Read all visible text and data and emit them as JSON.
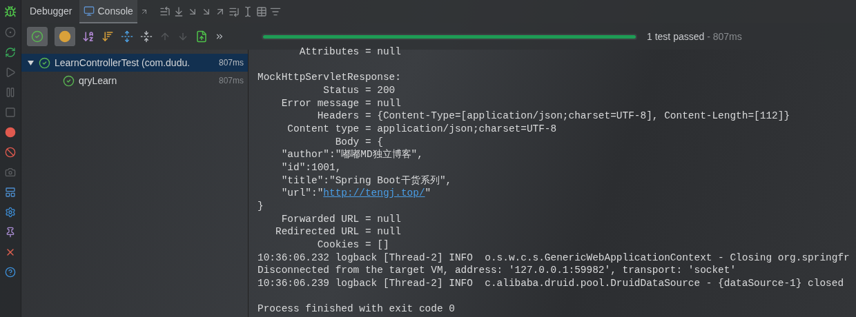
{
  "tabs": [
    {
      "label": "Debugger",
      "selected": false
    },
    {
      "label": "Console",
      "selected": true
    }
  ],
  "filters": [
    {
      "kind": "passed",
      "checked": true
    },
    {
      "kind": "ignored",
      "checked": true
    }
  ],
  "progress": {
    "level": 1.0,
    "status": "1 test passed",
    "time": " - 807ms"
  },
  "tree": [
    {
      "label": "LearnControllerTest (com.dudu.",
      "time": "807ms",
      "expanded": true,
      "selected": true,
      "children": [
        {
          "label": "qryLearn",
          "time": "807ms",
          "selected": false
        }
      ]
    }
  ],
  "console": [
    {
      "text": "       Attributes = null"
    },
    {
      "text": "MockHttpServletResponse:",
      "gap_before": true
    },
    {
      "text": "           Status = 200"
    },
    {
      "text": "    Error message = null"
    },
    {
      "text": "          Headers = {Content-Type=[application/json;charset=UTF-8], Content-Length=[112]}"
    },
    {
      "text": "     Content type = application/json;charset=UTF-8"
    },
    {
      "text": "             Body = {"
    },
    {
      "text": "    \"author\":\"嘟嘟MD独立博客\","
    },
    {
      "text": "    \"id\":1001,"
    },
    {
      "text": "    \"title\":\"Spring Boot干货系列\","
    },
    {
      "text": "    \"url\":\"",
      "link": "http://tengj.top/",
      "after": "\""
    },
    {
      "text": "}"
    },
    {
      "text": "    Forwarded URL = null"
    },
    {
      "text": "   Redirected URL = null"
    },
    {
      "text": "          Cookies = []"
    },
    {
      "text": "10:36:06.232 logback [Thread-2] INFO  o.s.w.c.s.GenericWebApplicationContext - Closing org.springfr"
    },
    {
      "text": "Disconnected from the target VM, address: '127.0.0.1:59982', transport: 'socket'"
    },
    {
      "text": "10:36:06.239 logback [Thread-2] INFO  c.alibaba.druid.pool.DruidDataSource - {dataSource-1} closed"
    },
    {
      "text": "Process finished with exit code 0",
      "gap_before": true
    }
  ]
}
